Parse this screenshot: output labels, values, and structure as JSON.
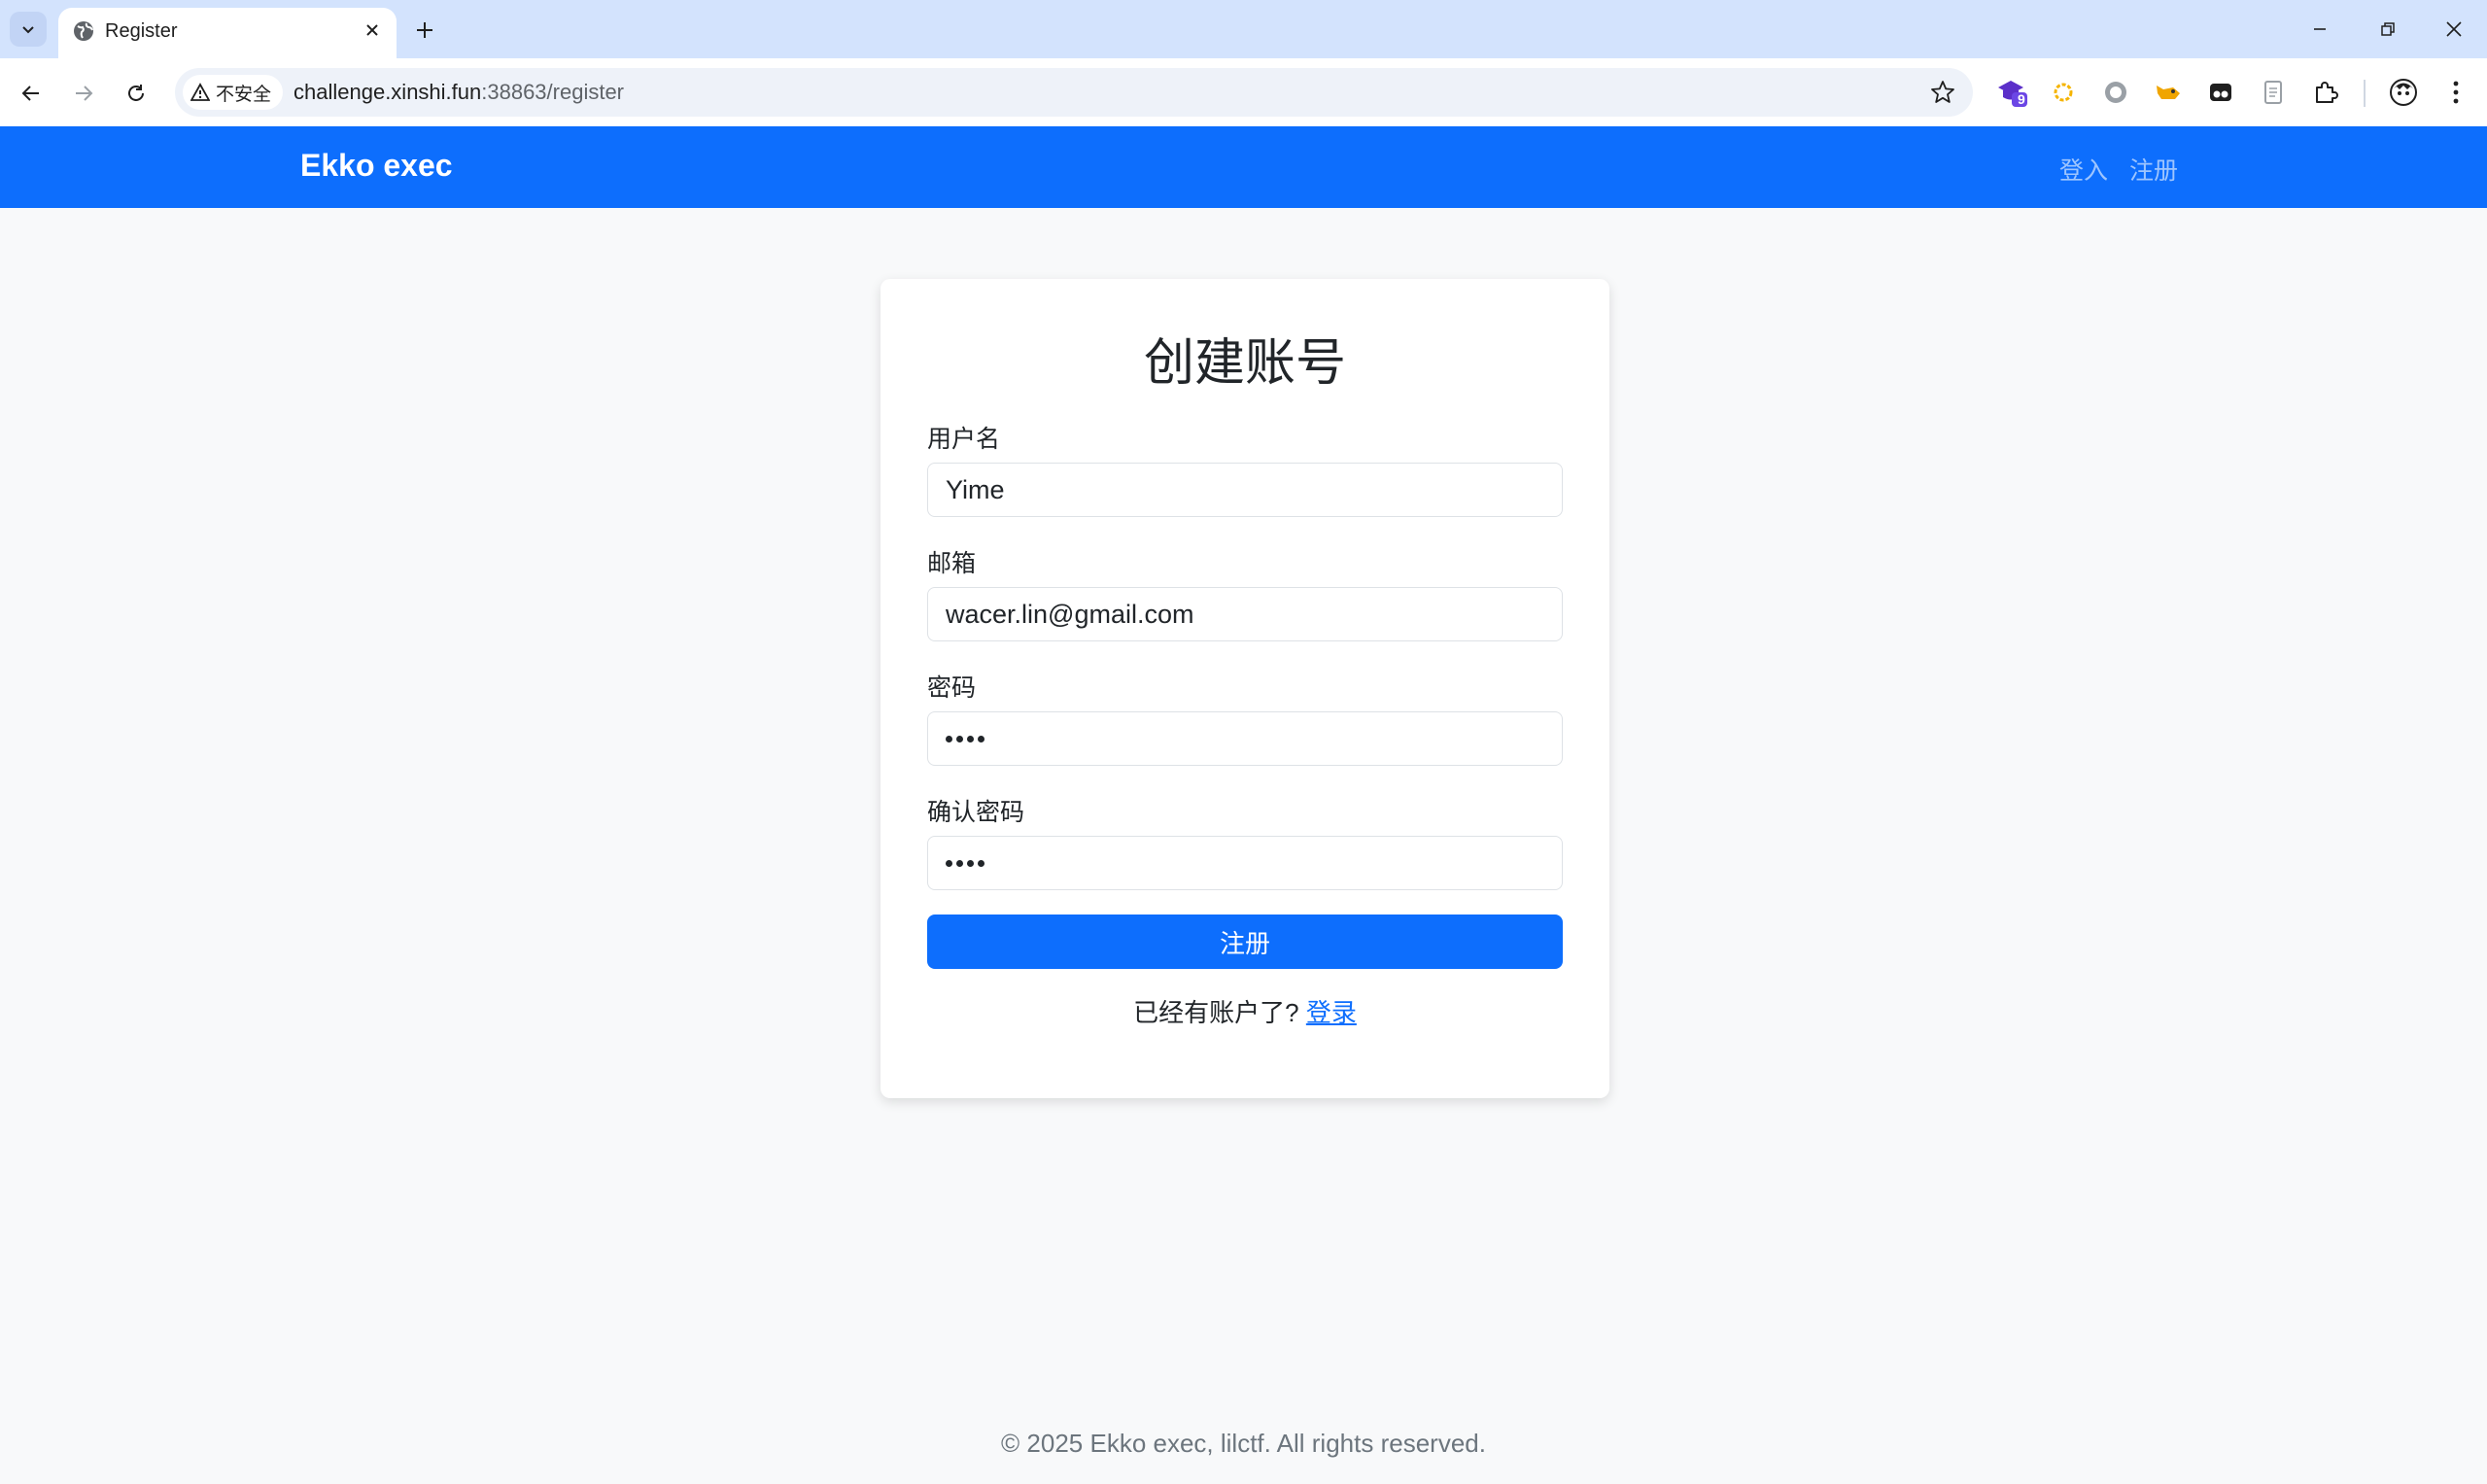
{
  "browser": {
    "tab_title": "Register",
    "insecure_label": "不安全",
    "url_host": "challenge.xinshi.fun",
    "url_port_path": ":38863/register",
    "extension_badge": "9"
  },
  "site": {
    "brand": "Ekko exec",
    "nav": {
      "login": "登入",
      "register": "注册"
    }
  },
  "form": {
    "title": "创建账号",
    "username_label": "用户名",
    "username_value": "Yime",
    "email_label": "邮箱",
    "email_value": "wacer.lin@gmail.com",
    "password_label": "密码",
    "confirm_label": "确认密码",
    "submit_label": "注册",
    "have_account_text": "已经有账户了?",
    "login_link": "登录"
  },
  "footer": {
    "text": "© 2025 Ekko exec, lilctf. All rights reserved."
  },
  "colors": {
    "primary": "#0d6efd",
    "tabbar": "#d3e3fd",
    "page_bg": "#f8f9fa"
  }
}
